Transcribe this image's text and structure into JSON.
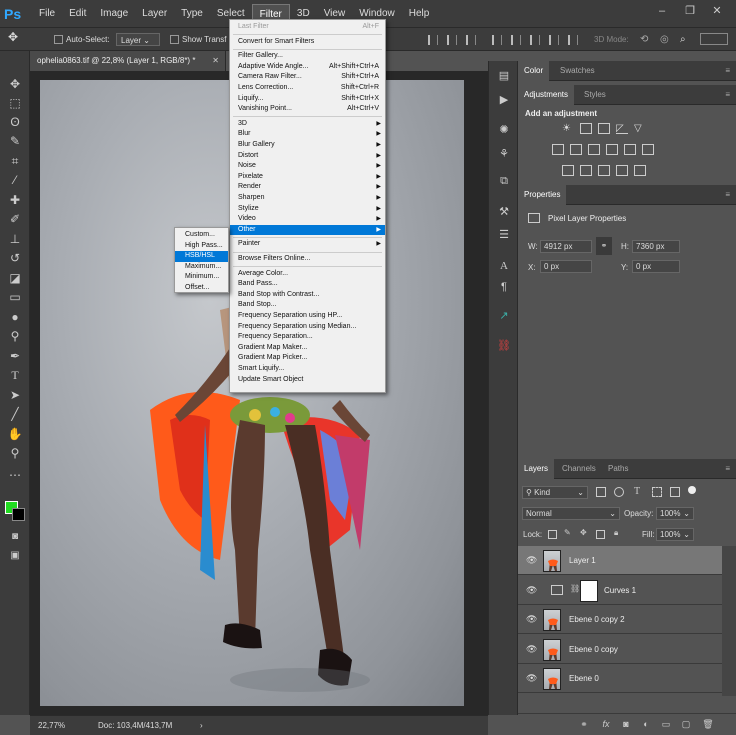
{
  "app": {
    "logo": "Ps"
  },
  "menubar": {
    "items": [
      "File",
      "Edit",
      "Image",
      "Layer",
      "Type",
      "Select",
      "Filter",
      "3D",
      "View",
      "Window",
      "Help"
    ],
    "active": "Filter"
  },
  "window_controls": {
    "minimize": "–",
    "restore": "❐",
    "close": "✕"
  },
  "options_bar": {
    "auto_select_label": "Auto-Select:",
    "auto_select_value": "Layer",
    "show_transform_label": "Show Transf",
    "mode_3d_label": "3D Mode:"
  },
  "document": {
    "tab_title": "ophelia0863.tif @ 22,8% (Layer 1, RGB/8*) *",
    "zoom": "22,77%",
    "doc_size": "Doc: 103,4M/413,7M"
  },
  "filter_menu": {
    "items": [
      {
        "label": "Last Filter",
        "shortcut": "Alt+F",
        "disabled": true
      },
      {
        "sep": true
      },
      {
        "label": "Convert for Smart Filters"
      },
      {
        "sep": true
      },
      {
        "label": "Filter Gallery..."
      },
      {
        "label": "Adaptive Wide Angle...",
        "shortcut": "Alt+Shift+Ctrl+A"
      },
      {
        "label": "Camera Raw Filter...",
        "shortcut": "Shift+Ctrl+A"
      },
      {
        "label": "Lens Correction...",
        "shortcut": "Shift+Ctrl+R"
      },
      {
        "label": "Liquify...",
        "shortcut": "Shift+Ctrl+X"
      },
      {
        "label": "Vanishing Point...",
        "shortcut": "Alt+Ctrl+V"
      },
      {
        "sep": true
      },
      {
        "label": "3D",
        "submenu": true
      },
      {
        "label": "Blur",
        "submenu": true
      },
      {
        "label": "Blur Gallery",
        "submenu": true
      },
      {
        "label": "Distort",
        "submenu": true
      },
      {
        "label": "Noise",
        "submenu": true
      },
      {
        "label": "Pixelate",
        "submenu": true
      },
      {
        "label": "Render",
        "submenu": true
      },
      {
        "label": "Sharpen",
        "submenu": true
      },
      {
        "label": "Stylize",
        "submenu": true
      },
      {
        "label": "Video",
        "submenu": true
      },
      {
        "label": "Other",
        "submenu": true,
        "highlighted": true
      },
      {
        "sep": true
      },
      {
        "label": "Painter",
        "submenu": true
      },
      {
        "sep": true
      },
      {
        "label": "Browse Filters Online..."
      },
      {
        "sep": true
      },
      {
        "label": "Average Color..."
      },
      {
        "label": "Band Pass..."
      },
      {
        "label": "Band Stop with Contrast..."
      },
      {
        "label": "Band Stop..."
      },
      {
        "label": "Frequency Separation using HP..."
      },
      {
        "label": "Frequency Separation using Median..."
      },
      {
        "label": "Frequency Separation..."
      },
      {
        "label": "Gradient Map Maker..."
      },
      {
        "label": "Gradient Map Picker..."
      },
      {
        "label": "Smart Liquify..."
      },
      {
        "label": "Update Smart Object"
      }
    ]
  },
  "other_submenu": {
    "items": [
      "Custom...",
      "High Pass...",
      "HSB/HSL",
      "Maximum...",
      "Minimum...",
      "Offset..."
    ],
    "highlighted": "HSB/HSL"
  },
  "panels": {
    "color_tabs": [
      "Color",
      "Swatches"
    ],
    "adjustments_tabs": [
      "Adjustments",
      "Styles"
    ],
    "add_adjustment": "Add an adjustment",
    "properties_tab": "Properties",
    "properties_title": "Pixel Layer Properties",
    "w_label": "W:",
    "w_value": "4912 px",
    "h_label": "H:",
    "h_value": "7360 px",
    "x_label": "X:",
    "x_value": "0 px",
    "y_label": "Y:",
    "y_value": "0 px"
  },
  "layers_panel": {
    "tabs": [
      "Layers",
      "Channels",
      "Paths"
    ],
    "kind": "Kind",
    "blend_mode": "Normal",
    "opacity_label": "Opacity:",
    "opacity_value": "100%",
    "lock_label": "Lock:",
    "fill_label": "Fill:",
    "fill_value": "100%",
    "layers": [
      {
        "name": "Layer 1",
        "selected": true
      },
      {
        "name": "Curves 1",
        "adjustment": true
      },
      {
        "name": "Ebene 0 copy 2"
      },
      {
        "name": "Ebene 0 copy"
      },
      {
        "name": "Ebene 0"
      }
    ],
    "bottom_fx": "fx"
  },
  "colors": {
    "foreground": "#22dd22",
    "background": "#000000",
    "highlight": "#0078d7",
    "accent_blue": "#31a8ff"
  }
}
